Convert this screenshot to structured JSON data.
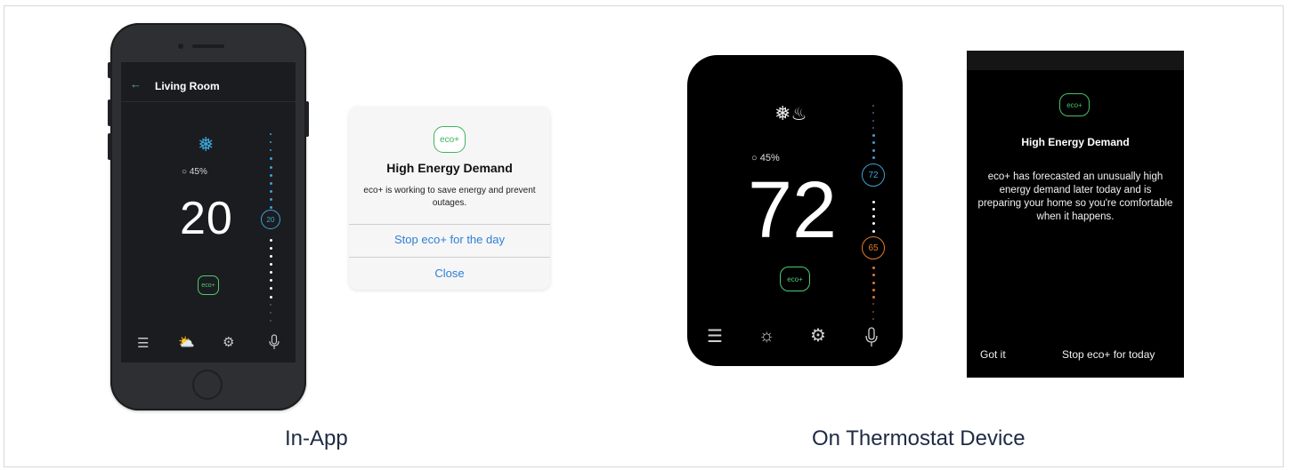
{
  "captions": {
    "in_app": "In-App",
    "device": "On Thermostat Device"
  },
  "app": {
    "header_title": "Living Room",
    "humidity": "45%",
    "temperature": "20",
    "setpoint": "20",
    "eco_label": "eco+",
    "nav_icons": [
      "menu-icon",
      "weather-icon",
      "settings-icon",
      "microphone-icon"
    ]
  },
  "dialog": {
    "eco_label": "eco+",
    "title": "High Energy Demand",
    "message": "eco+ is working to save energy and prevent outages.",
    "stop_button": "Stop eco+ for the day",
    "close_button": "Close"
  },
  "thermostat": {
    "humidity": "45%",
    "temperature": "72",
    "cool_setpoint": "72",
    "heat_setpoint": "65",
    "eco_label": "eco+"
  },
  "device_alert": {
    "eco_label": "eco+",
    "title": "High Energy Demand",
    "message": "eco+ has forecasted an unusually high energy demand later today and is preparing your home so you're comfortable when it happens.",
    "got_it_button": "Got it",
    "stop_button": "Stop eco+ for today"
  },
  "colors": {
    "eco_green": "#4fcb6c",
    "cool_blue": "#3ea0d8",
    "heat_orange": "#e17a2a",
    "link_blue": "#2f7fd6"
  }
}
